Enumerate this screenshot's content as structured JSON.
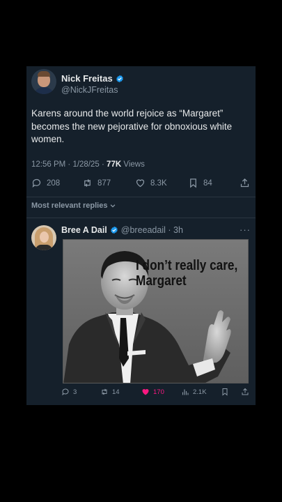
{
  "tweet": {
    "author_name": "Nick Freitas",
    "author_handle": "@NickJFreitas",
    "text": "Karens around the world rejoice as “Margaret” becomes the new pejorative for obnoxious white women.",
    "timestamp": "12:56 PM · 1/28/25 · ",
    "views_count": "77K",
    "views_label": " Views",
    "stats": {
      "replies": "208",
      "reposts": "877",
      "likes": "8.3K",
      "bookmarks": "84"
    }
  },
  "sort_label": "Most relevant replies",
  "reply": {
    "author_name": "Bree A Dail",
    "author_handle": "@breeadail · 3h",
    "more": "···",
    "meme_caption_line1": "I don’t really care,",
    "meme_caption_line2": "Margaret",
    "stats": {
      "replies": "3",
      "reposts": "14",
      "likes": "170",
      "views": "2.1K"
    }
  },
  "colors": {
    "background": "#000000",
    "card": "#15202b",
    "verified": "#1d9bf0",
    "like_active": "#f91880",
    "muted": "#8b98a5"
  }
}
